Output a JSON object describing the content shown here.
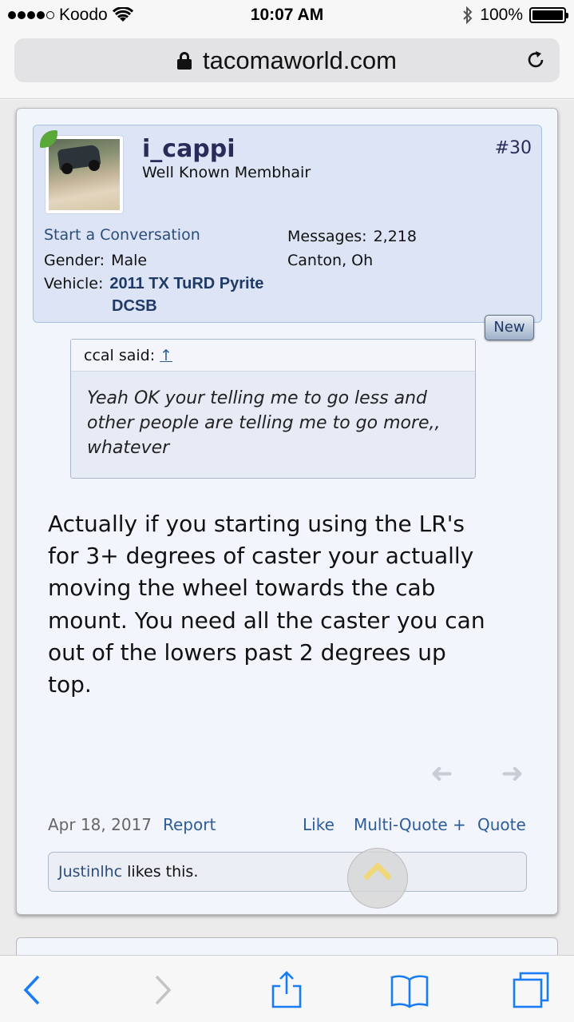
{
  "status_bar": {
    "carrier": "Koodo",
    "time": "10:07 AM",
    "battery": "100%"
  },
  "browser": {
    "url": "tacomaworld.com"
  },
  "post": {
    "username": "i_cappi",
    "user_title": "Well Known Membhair",
    "post_number": "#30",
    "start_conversation": "Start a Conversation",
    "messages_label": "Messages:",
    "messages_value": "2,218",
    "location": "Canton, Oh",
    "gender_label": "Gender:",
    "gender_value": "Male",
    "vehicle_label": "Vehicle:",
    "vehicle_value_line1": "2011 TX TuRD Pyrite",
    "vehicle_value_line2": "DCSB",
    "new_badge": "New",
    "quote": {
      "author": "ccal said:",
      "arrow": "↑",
      "text": "Yeah OK your telling me to go less and other people are telling me to go more,, whatever"
    },
    "message": "Actually if you starting using the LR's for 3+ degrees of caster your actually moving the wheel towards the cab mount. You need all the caster you can out of the lowers past 2 degrees up top.",
    "date": "Apr 18, 2017",
    "report": "Report",
    "like": "Like",
    "multi_quote": "Multi-Quote +",
    "quote_action": "Quote",
    "liker": "Justinlhc",
    "likes_suffix": " likes this."
  },
  "colors": {
    "link": "#2c5d9a",
    "user_box_bg": "#dde4f5",
    "toolbar_icon": "#1a7cf5"
  }
}
